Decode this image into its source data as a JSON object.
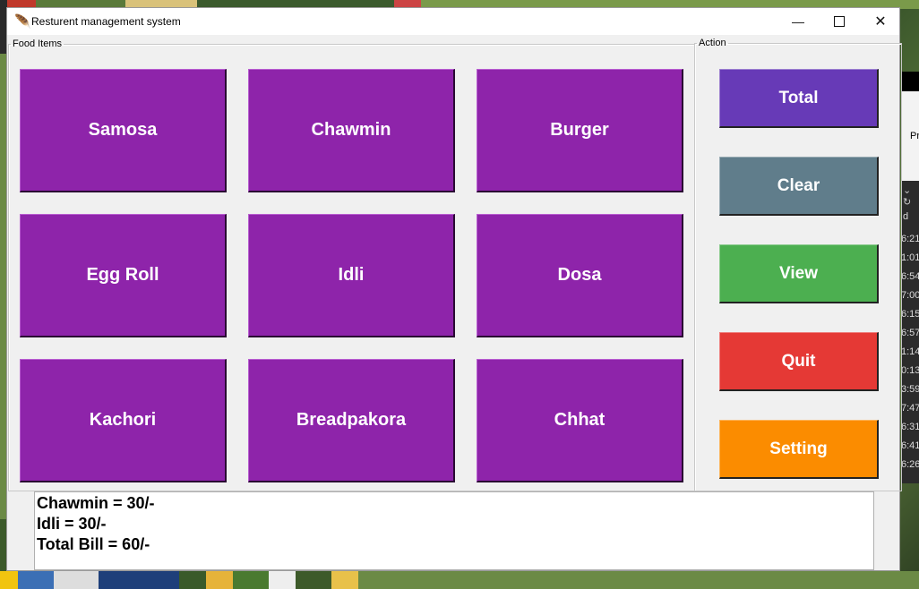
{
  "window": {
    "title": "Resturent management system"
  },
  "food_frame": {
    "label": "Food Items",
    "items": [
      "Samosa",
      "Chawmin",
      "Burger",
      "Egg Roll",
      "Idli",
      "Dosa",
      "Kachori",
      "Breadpakora",
      "Chhat"
    ]
  },
  "action_frame": {
    "label": "Action",
    "buttons": [
      {
        "label": "Total",
        "color": "#673ab7"
      },
      {
        "label": "Clear",
        "color": "#607d8b"
      },
      {
        "label": "View",
        "color": "#4caf50"
      },
      {
        "label": "Quit",
        "color": "#e53935"
      },
      {
        "label": "Setting",
        "color": "#fb8c00"
      }
    ]
  },
  "food_button_color": "#8e24aa",
  "bill": {
    "lines": [
      "Chawmin = 30/-",
      "Idli = 30/-",
      "Total Bill = 60/-"
    ]
  },
  "background_app": {
    "label_fragment": "Pr",
    "column_fragment": "d",
    "times": [
      "6:21",
      "1:01",
      "6:54",
      "7:00",
      "6:15",
      "6:57",
      "1:14",
      "0:13",
      "3:59",
      "7:47",
      "6:31",
      "6:41",
      "6:26"
    ]
  }
}
